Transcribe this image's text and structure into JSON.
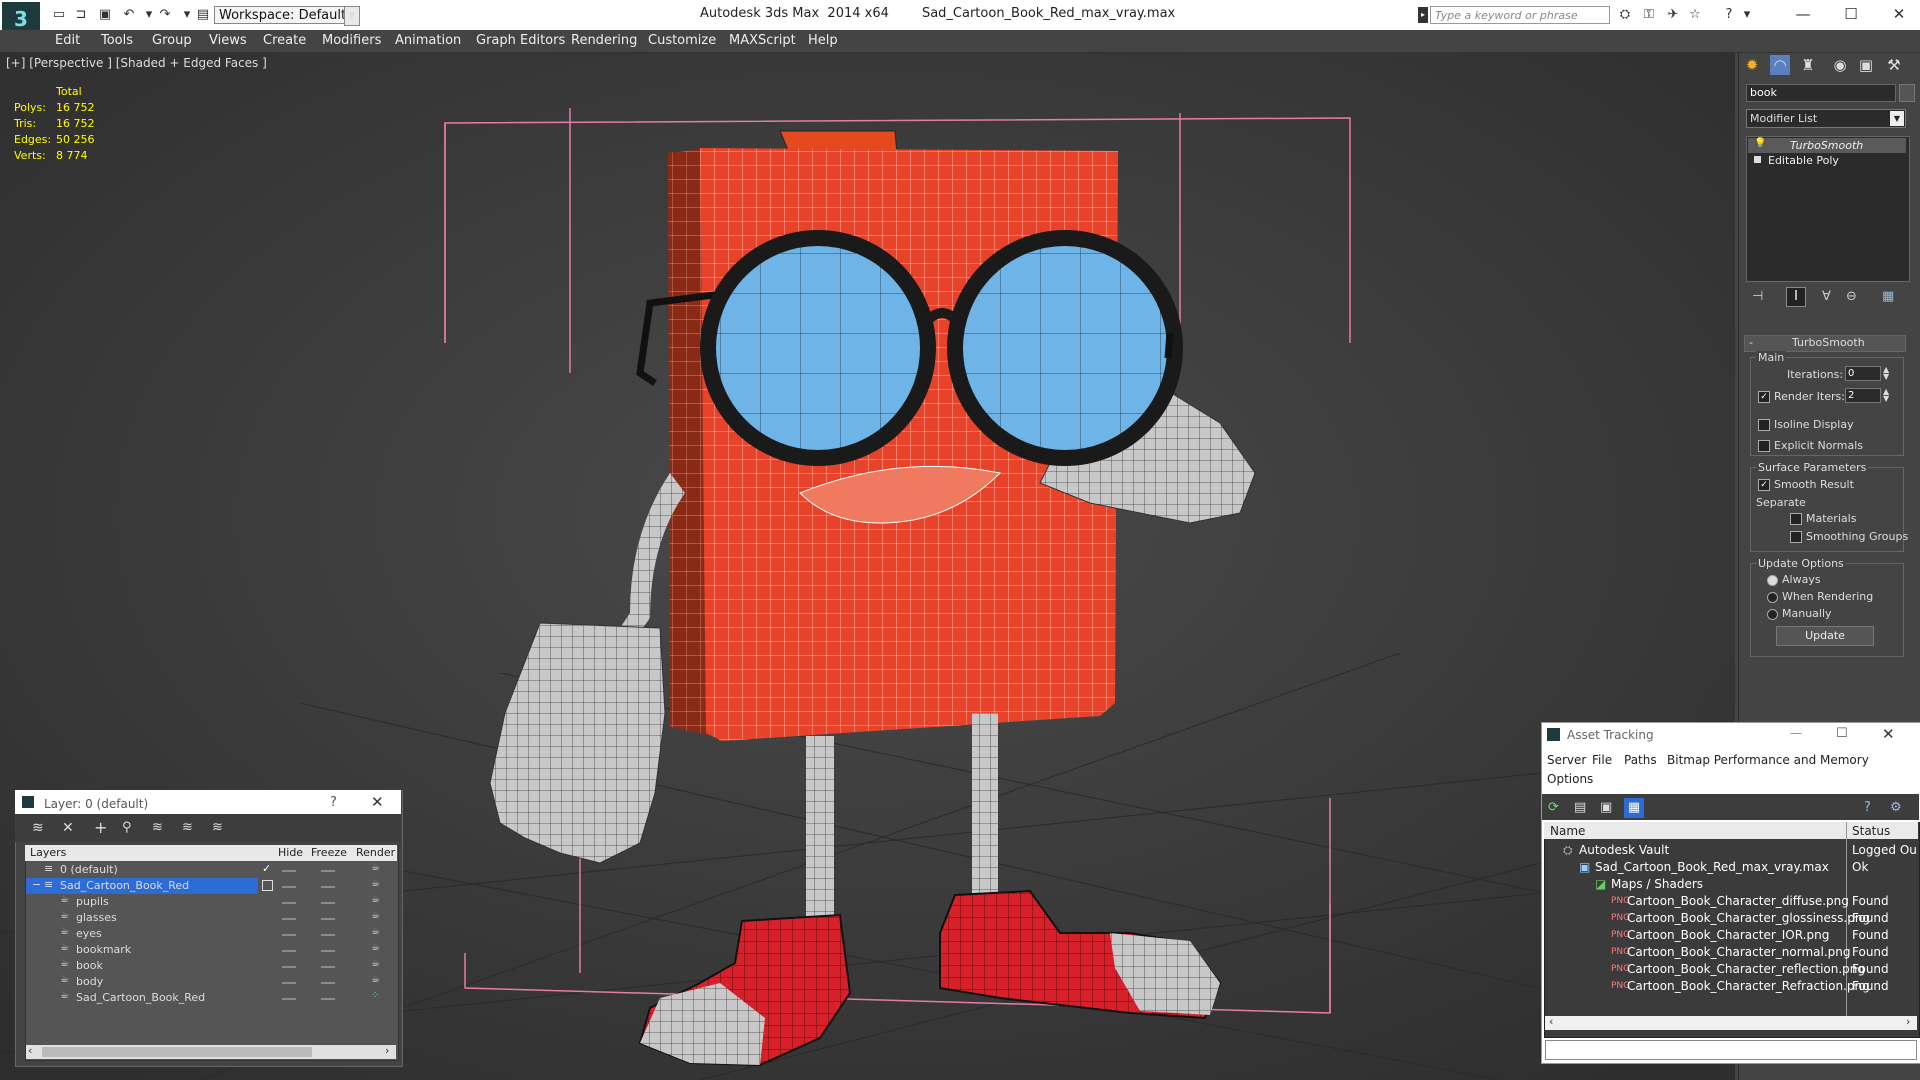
{
  "titlebar": {
    "app_title": "Autodesk 3ds Max  2014 x64",
    "file_name": "Sad_Cartoon_Book_Red_max_vray.max",
    "workspace": "Workspace: Default",
    "search_placeholder": "Type a keyword or phrase"
  },
  "menu": [
    "Edit",
    "Tools",
    "Group",
    "Views",
    "Create",
    "Modifiers",
    "Animation",
    "Graph Editors",
    "Rendering",
    "Customize",
    "MAXScript",
    "Help"
  ],
  "viewport": {
    "label": "[+] [Perspective ] [Shaded + Edged Faces ]",
    "stats_header": "Total",
    "stats": [
      {
        "label": "Polys:",
        "value": "16 752"
      },
      {
        "label": "Tris:",
        "value": "16 752"
      },
      {
        "label": "Edges:",
        "value": "50 256"
      },
      {
        "label": "Verts:",
        "value": "8 774"
      }
    ]
  },
  "command_panel": {
    "object_name": "book",
    "modifier_list": "Modifier List",
    "stack": [
      "TurboSmooth",
      "Editable Poly"
    ],
    "rollout_title": "TurboSmooth",
    "main_label": "Main",
    "iterations_label": "Iterations:",
    "iterations_value": "0",
    "render_iters_label": "Render Iters:",
    "render_iters_value": "2",
    "isoline": "Isoline Display",
    "explicit_normals": "Explicit Normals",
    "surface_params": "Surface Parameters",
    "smooth_result": "Smooth Result",
    "separate": "Separate",
    "materials": "Materials",
    "smoothing_groups": "Smoothing Groups",
    "update_options": "Update Options",
    "always": "Always",
    "when_rendering": "When Rendering",
    "manually": "Manually",
    "update_button": "Update"
  },
  "layer_window": {
    "title": "Layer: 0 (default)",
    "help": "?",
    "columns": [
      "Layers",
      "Hide",
      "Freeze",
      "Render"
    ],
    "rows": [
      {
        "name": "0 (default)",
        "indent": 0,
        "selected": false
      },
      {
        "name": "Sad_Cartoon_Book_Red",
        "indent": 0,
        "selected": true
      },
      {
        "name": "pupils",
        "indent": 1,
        "selected": false
      },
      {
        "name": "glasses",
        "indent": 1,
        "selected": false
      },
      {
        "name": "eyes",
        "indent": 1,
        "selected": false
      },
      {
        "name": "bookmark",
        "indent": 1,
        "selected": false
      },
      {
        "name": "book",
        "indent": 1,
        "selected": false
      },
      {
        "name": "body",
        "indent": 1,
        "selected": false
      },
      {
        "name": "Sad_Cartoon_Book_Red",
        "indent": 1,
        "selected": false
      }
    ]
  },
  "asset_tracking": {
    "title": "Asset Tracking",
    "menu": [
      "Server",
      "File",
      "Paths",
      "Bitmap Performance and Memory",
      "Options"
    ],
    "col_name": "Name",
    "col_status": "Status",
    "rows": [
      {
        "name": "Autodesk Vault",
        "status": "Logged Ou",
        "level": 0
      },
      {
        "name": "Sad_Cartoon_Book_Red_max_vray.max",
        "status": "Ok",
        "level": 1
      },
      {
        "name": "Maps / Shaders",
        "status": "",
        "level": 2
      },
      {
        "name": "Cartoon_Book_Character_diffuse.png",
        "status": "Found",
        "level": 3
      },
      {
        "name": "Cartoon_Book_Character_glossiness.png",
        "status": "Found",
        "level": 3
      },
      {
        "name": "Cartoon_Book_Character_IOR.png",
        "status": "Found",
        "level": 3
      },
      {
        "name": "Cartoon_Book_Character_normal.png",
        "status": "Found",
        "level": 3
      },
      {
        "name": "Cartoon_Book_Character_reflection.png",
        "status": "Found",
        "level": 3
      },
      {
        "name": "Cartoon_Book_Character_Refraction.png",
        "status": "Found",
        "level": 3
      }
    ]
  },
  "colors": {
    "book_red": "#e8432a",
    "lens_blue": "#6fb4e6",
    "selection_blue": "#2d6bd6",
    "stat_yellow": "#ffff00"
  }
}
